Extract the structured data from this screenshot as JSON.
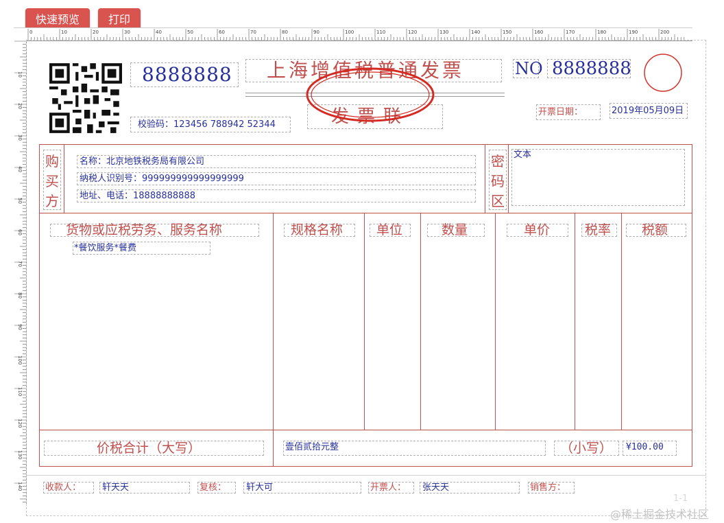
{
  "toolbar": {
    "preview_label": "快速预览",
    "print_label": "打印"
  },
  "ruler": {
    "top_ticks": [
      "0",
      "10",
      "20",
      "30",
      "40",
      "50",
      "60",
      "70",
      "80",
      "90",
      "100",
      "110",
      "120",
      "130",
      "140",
      "150",
      "160",
      "170",
      "180",
      "190",
      "200"
    ],
    "left_ticks": [
      "10",
      "20",
      "30",
      "40",
      "50",
      "60",
      "70",
      "80",
      "90",
      "100",
      "110",
      "120",
      "130",
      "140"
    ]
  },
  "invoice": {
    "code": "8888888",
    "title": "上海增值税普通发票",
    "no_label": "NO",
    "number": "8888888",
    "subtitle": "发票联",
    "check_code": "校验码：123456 788942 52344",
    "date_label": "开票日期：",
    "date_value": "2019年05月09日",
    "buyer": {
      "side_label": [
        "购",
        "买",
        "方"
      ],
      "name": "名称：北京地铁税务局有限公司",
      "tax_id": "纳税人识别号：999999999999999999",
      "address": "地址、电话：18888888888"
    },
    "cipher": {
      "side_label": [
        "密",
        "码",
        "区"
      ],
      "text": "文本"
    },
    "columns": [
      "货物或应税劳务、服务名称",
      "规格名称",
      "单位",
      "数量",
      "单价",
      "税率",
      "税额"
    ],
    "items": [
      "*餐饮服务*餐费"
    ],
    "total": {
      "label_cn": "价税合计（大写）",
      "amount_cn": "壹佰贰拾元整",
      "small_label": "（小写）",
      "amount": "¥100.00"
    },
    "footer": {
      "payee_label": "收款人：",
      "payee": "轩天天",
      "reviewer_label": "复核：",
      "reviewer": "轩大可",
      "issuer_label": "开票人：",
      "issuer": "张天天",
      "seller_label": "销售方："
    },
    "page_indicator": "1-1"
  },
  "watermark": "@稀土掘金技术社区",
  "colors": {
    "button": "#d9534f",
    "frame_red": "#c0504d",
    "value_blue": "#27309a"
  }
}
